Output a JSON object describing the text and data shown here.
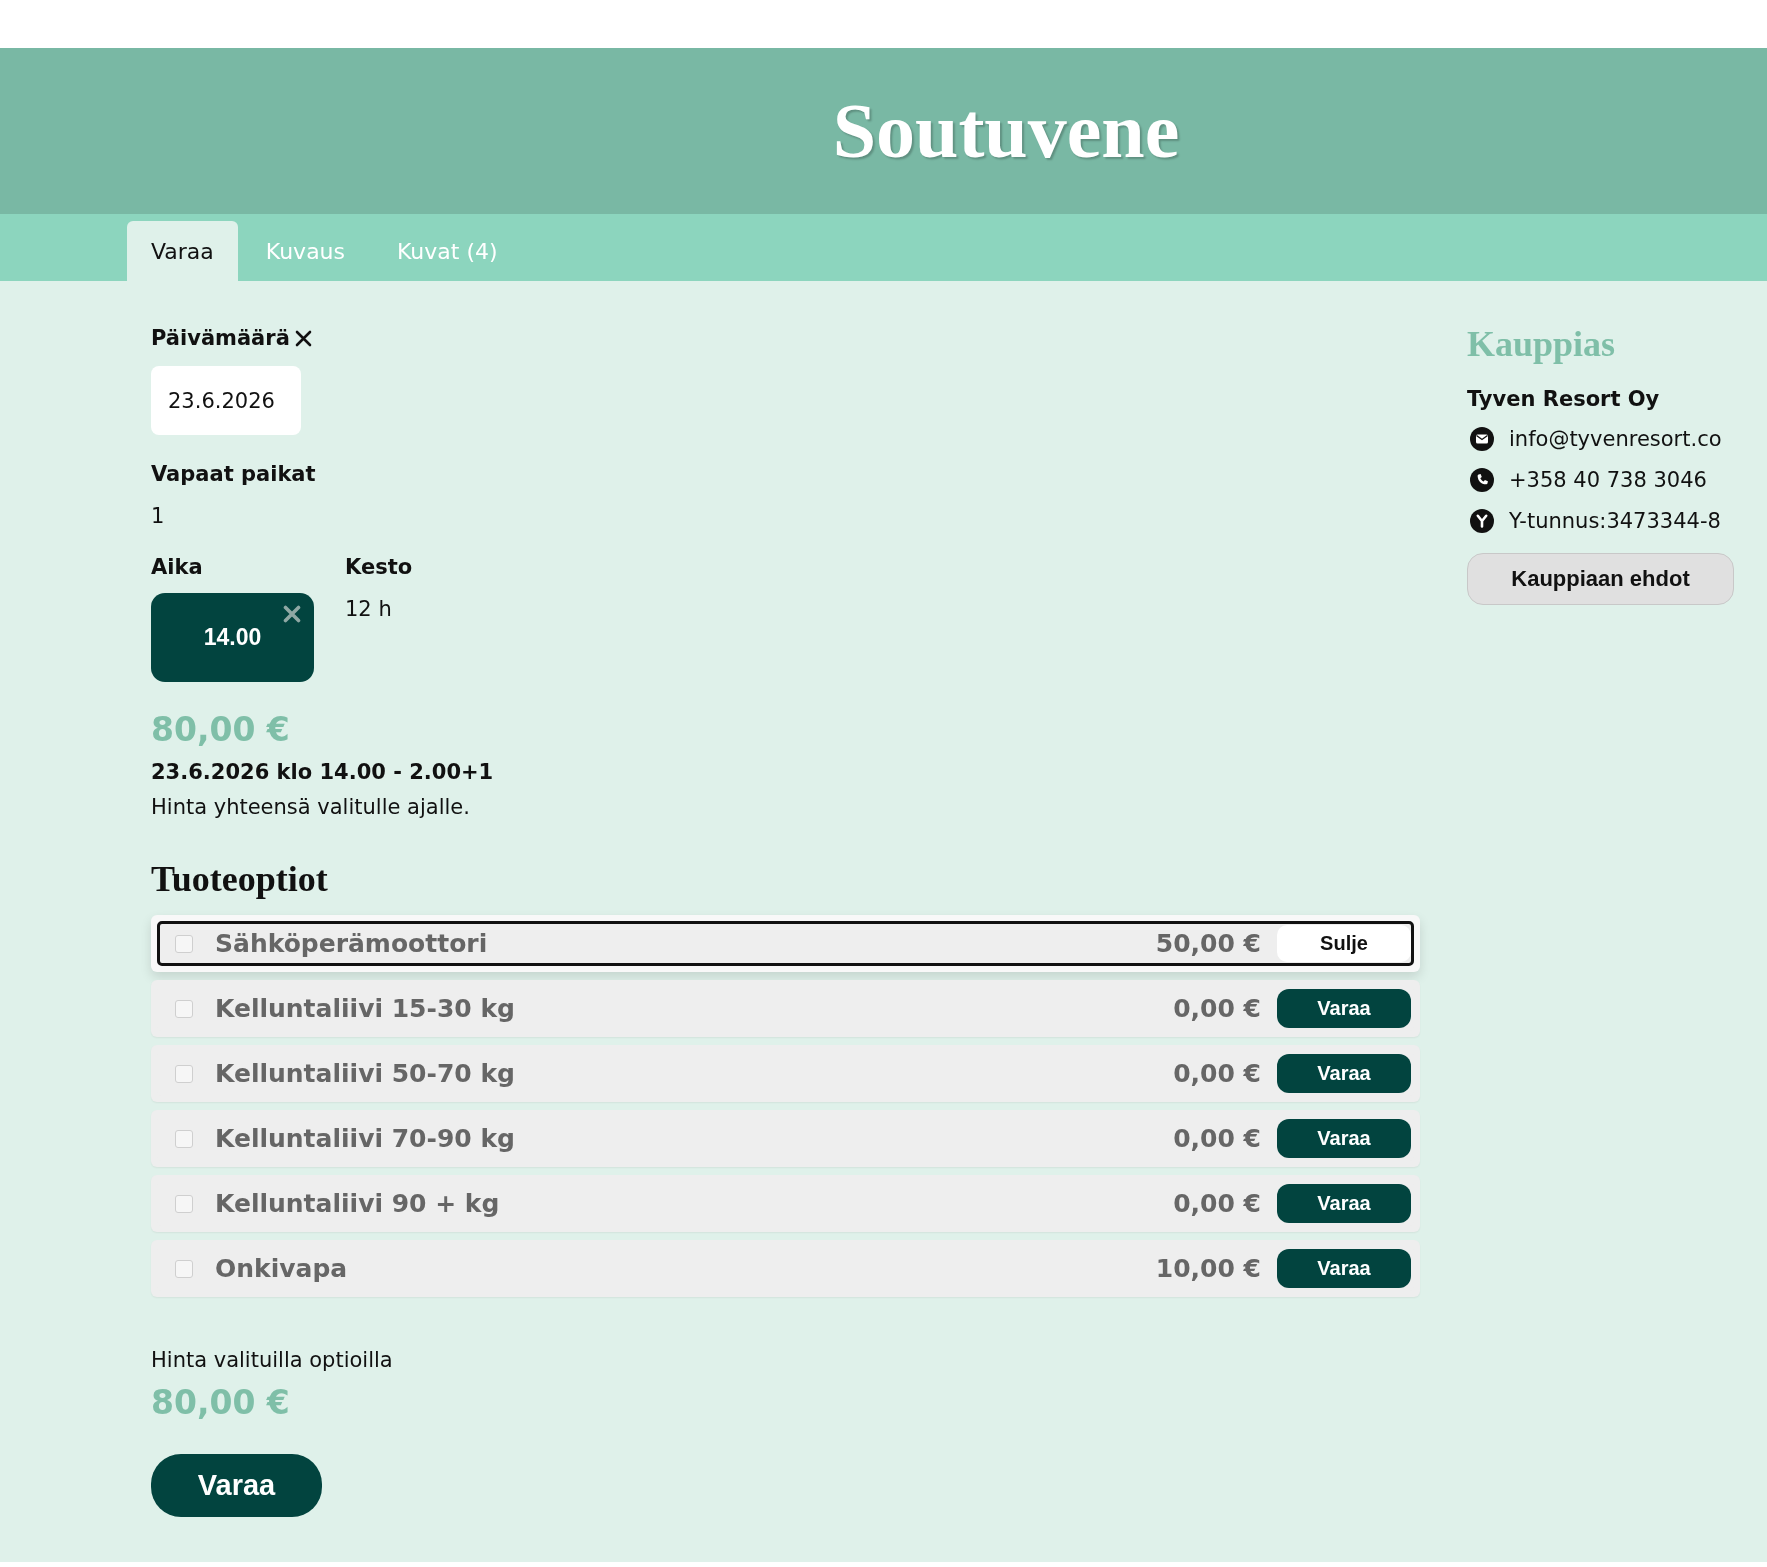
{
  "header": {
    "title": "Soutuvene"
  },
  "tabs": [
    {
      "label": "Varaa",
      "selected": true
    },
    {
      "label": "Kuvaus",
      "selected": false
    },
    {
      "label": "Kuvat (4)",
      "selected": false
    }
  ],
  "booking": {
    "date": {
      "label": "Päivämäärä",
      "value": "23.6.2026"
    },
    "availability": {
      "label": "Vapaat paikat",
      "value": "1"
    },
    "time": {
      "label": "Aika",
      "slots": [
        {
          "label": "14.00",
          "selected": true
        }
      ]
    },
    "duration": {
      "label": "Kesto",
      "value": "12 h"
    },
    "price": "80,00 €",
    "summary": "23.6.2026 klo 14.00 - 2.00+1",
    "note": "Hinta yhteensä valitulle ajalle."
  },
  "options": {
    "title": "Tuoteoptiot",
    "items": [
      {
        "name": "Sähköperämoottori",
        "price": "50,00 €",
        "checked": false,
        "expanded": true,
        "button": "Sulje"
      },
      {
        "name": "Kelluntaliivi 15-30 kg",
        "price": "0,00 €",
        "checked": false,
        "expanded": false,
        "button": "Varaa"
      },
      {
        "name": "Kelluntaliivi 50-70 kg",
        "price": "0,00 €",
        "checked": false,
        "expanded": false,
        "button": "Varaa"
      },
      {
        "name": "Kelluntaliivi 70-90 kg",
        "price": "0,00 €",
        "checked": false,
        "expanded": false,
        "button": "Varaa"
      },
      {
        "name": "Kelluntaliivi 90 + kg",
        "price": "0,00 €",
        "checked": false,
        "expanded": false,
        "button": "Varaa"
      },
      {
        "name": "Onkivapa",
        "price": "10,00 €",
        "checked": false,
        "expanded": false,
        "button": "Varaa"
      }
    ]
  },
  "total": {
    "label": "Hinta valituilla optioilla",
    "price": "80,00 €"
  },
  "submit": "Varaa",
  "merchant": {
    "title": "Kauppias",
    "name": "Tyven Resort Oy",
    "contacts": [
      {
        "kind": "email",
        "text": "info@tyvenresort.co"
      },
      {
        "kind": "phone",
        "text": "+358 40 738 3046"
      },
      {
        "kind": "business_id",
        "text": "Y-tunnus:3473344-8"
      }
    ],
    "terms_button": "Kauppiaan ehdot"
  }
}
